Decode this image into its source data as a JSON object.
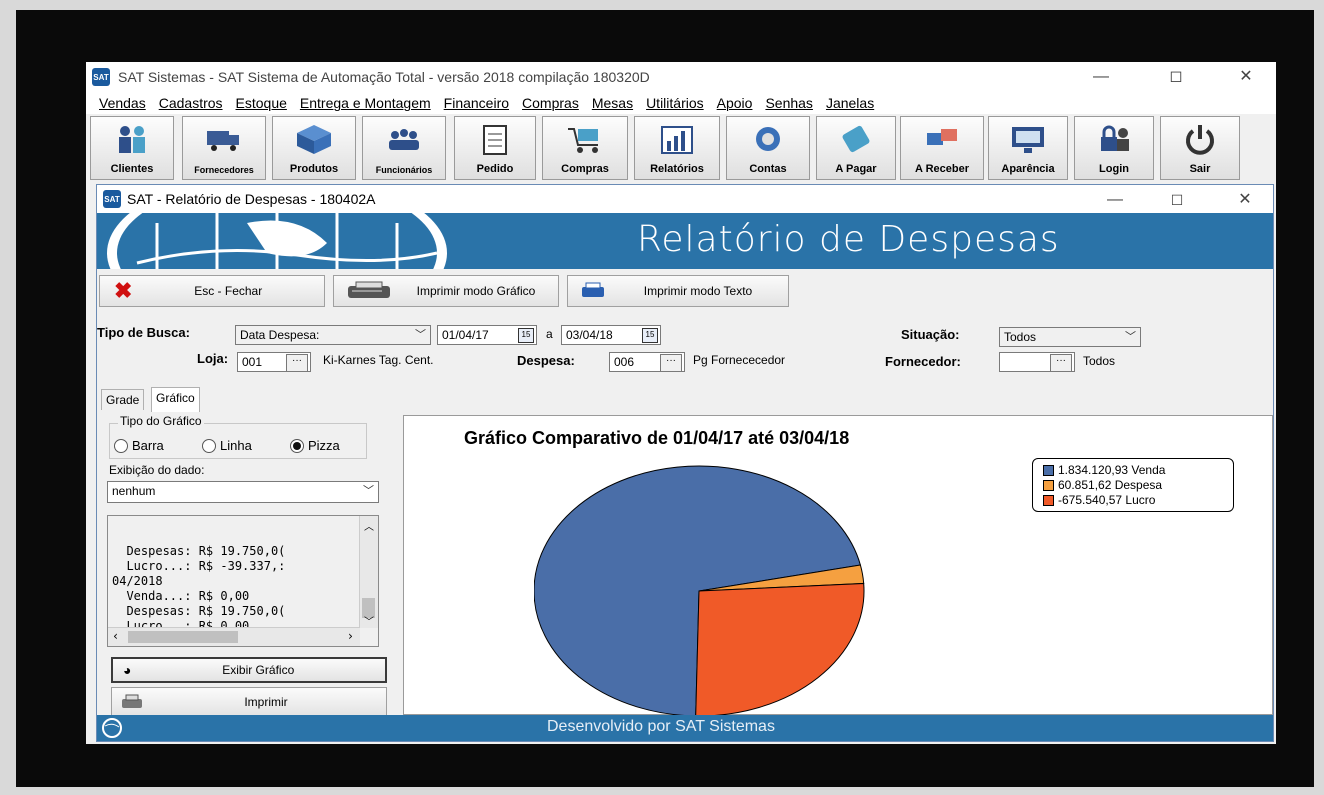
{
  "app": {
    "title": "SAT Sistemas - SAT Sistema de Automação Total - versão 2018 compilação 180320D",
    "icon_text": "SAT",
    "window_controls": {
      "minimize": "—",
      "maximize": "◻",
      "close": "✕"
    }
  },
  "menu": [
    "Vendas",
    "Cadastros",
    "Estoque",
    "Entrega e Montagem",
    "Financeiro",
    "Compras",
    "Mesas",
    "Utilitários",
    "Apoio",
    "Senhas",
    "Janelas"
  ],
  "toolbar": [
    {
      "label": "Clientes",
      "icon": "clients-icon"
    },
    {
      "label": "Fornecedores",
      "icon": "truck-icon"
    },
    {
      "label": "Produtos",
      "icon": "box-icon"
    },
    {
      "label": "Funcionários",
      "icon": "employees-icon"
    },
    {
      "label": "Pedido",
      "icon": "clipboard-icon"
    },
    {
      "label": "Compras",
      "icon": "cart-icon"
    },
    {
      "label": "Relatórios",
      "icon": "bar-chart-icon"
    },
    {
      "label": "Contas",
      "icon": "coins-icon"
    },
    {
      "label": "A Pagar",
      "icon": "pay-icon"
    },
    {
      "label": "A Receber",
      "icon": "receive-icon"
    },
    {
      "label": "Aparência",
      "icon": "monitor-icon"
    },
    {
      "label": "Login",
      "icon": "login-icon"
    },
    {
      "label": "Sair",
      "icon": "power-icon"
    }
  ],
  "child": {
    "title": "SAT - Relatório de Despesas - 180402A",
    "banner_title": "Relatório de Despesas",
    "buttons": {
      "fechar": "Esc - Fechar",
      "imprimir_grafico": "Imprimir modo Gráfico",
      "imprimir_texto": "Imprimir modo Texto"
    }
  },
  "filters": {
    "tipo_busca_label": "Tipo de Busca:",
    "tipo_busca_value": "Data Despesa:",
    "date_from": "01/04/17",
    "date_sep": "a",
    "date_to": "03/04/18",
    "situacao_label": "Situação:",
    "situacao_value": "Todos",
    "loja_label": "Loja:",
    "loja_code": "001",
    "loja_name": "Ki-Karnes Tag. Cent.",
    "despesa_label": "Despesa:",
    "despesa_code": "006",
    "despesa_name": "Pg Fornececedor",
    "fornecedor_label": "Fornecedor:",
    "fornecedor_code": "",
    "fornecedor_name": "Todos",
    "cal_icon": "15",
    "dots": "···"
  },
  "tabs": [
    "Grade",
    "Gráfico"
  ],
  "panel": {
    "group_title": "Tipo do Gráfico",
    "radios": [
      {
        "label": "Barra",
        "checked": false
      },
      {
        "label": "Linha",
        "checked": false
      },
      {
        "label": "Pizza",
        "checked": true
      }
    ],
    "exibicao_label": "Exibição do dado:",
    "exibicao_value": "nenhum",
    "text_lines": [
      "  Despesas: R$ 19.750,0(",
      "  Lucro...: R$ -39.337,:",
      "04/2018",
      "  Venda...: R$ 0,00",
      "  Despesas: R$ 19.750,0(",
      "  Lucro...: R$ 0,00"
    ],
    "btn_exibir": "Exibir Gráfico",
    "btn_imprimir": "Imprimir"
  },
  "chart_data": {
    "type": "pie",
    "title": "Gráfico Comparativo de 01/04/17 até 03/04/18",
    "legend_position": "top-right",
    "slices": [
      {
        "label": "1.834.120,93 Venda",
        "value": 1834120.93,
        "color": "#4a6ea8"
      },
      {
        "label": "60.851,62 Despesa",
        "value": 60851.62,
        "color": "#f5a040"
      },
      {
        "label": "-675.540,57 Lucro",
        "value": -675540.57,
        "color": "#f05a28"
      }
    ]
  },
  "status": {
    "text": "Desenvolvido por SAT Sistemas"
  }
}
